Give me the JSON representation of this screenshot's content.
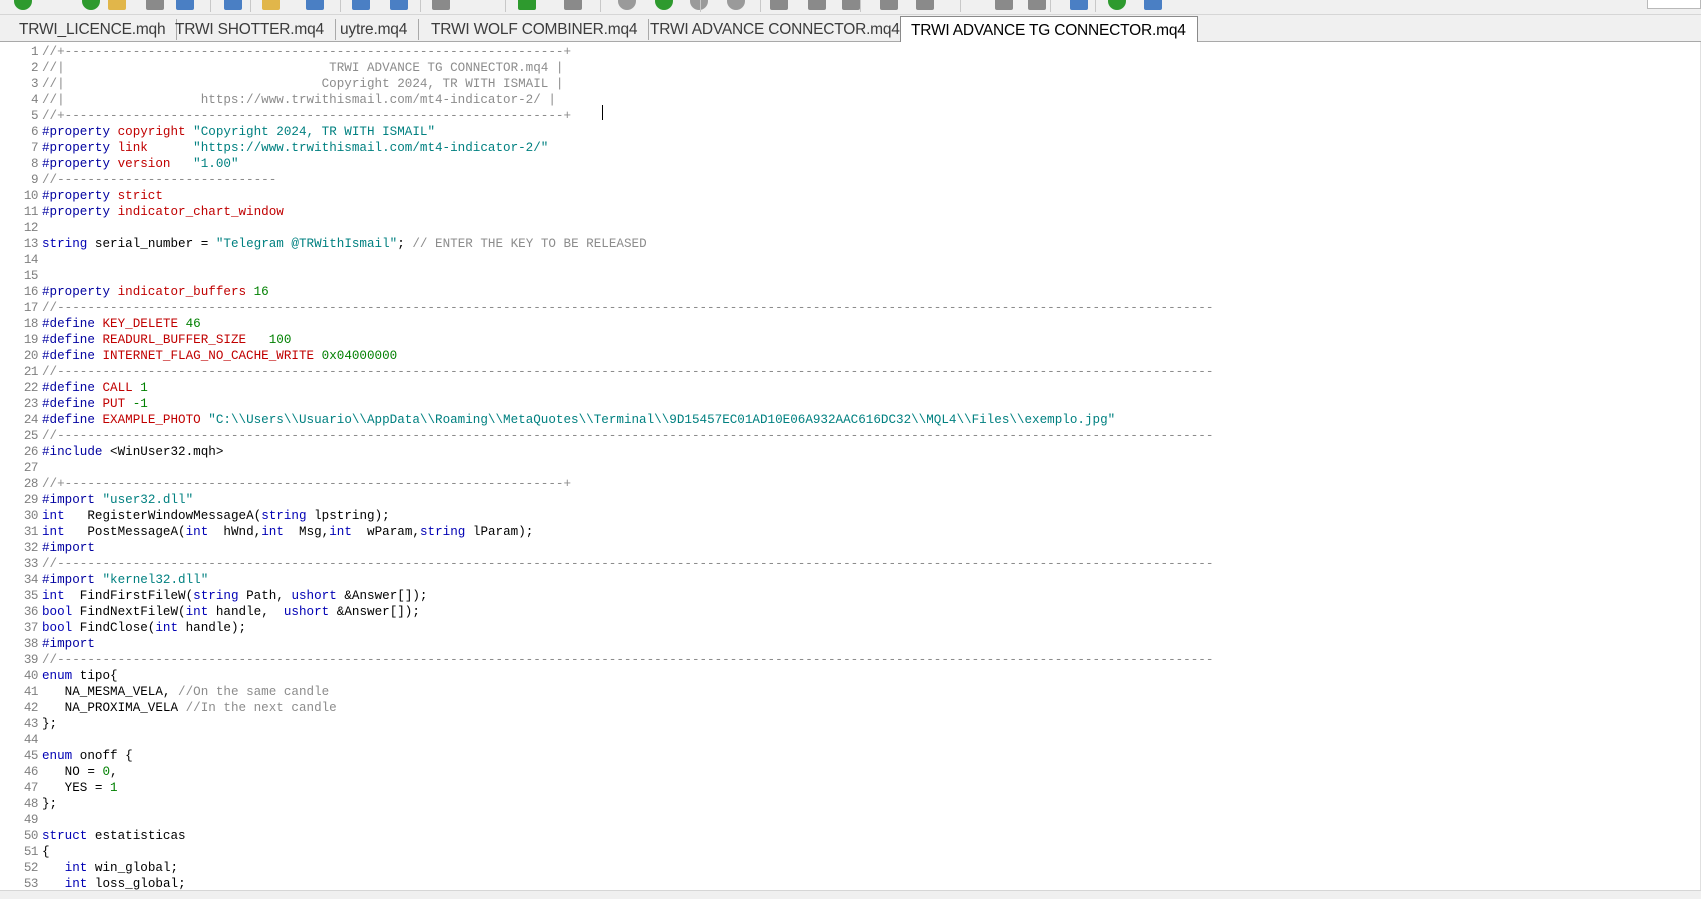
{
  "tabs": [
    {
      "label": "TRWI_LICENCE.mqh",
      "active": false
    },
    {
      "label": "TRWI SHOTTER.mq4",
      "active": false
    },
    {
      "label": "uytre.mq4",
      "active": false
    },
    {
      "label": "TRWI WOLF COMBINER.mq4",
      "active": false
    },
    {
      "label": "TRWI ADVANCE CONNECTOR.mq4",
      "active": false
    },
    {
      "label": "TRWI ADVANCE TG CONNECTOR.mq4",
      "active": true
    }
  ],
  "toolbar": {
    "icons": [
      "new-file-icon",
      "open-folder-icon",
      "save-icon",
      "save-all-icon",
      "compile-icon",
      "bookmark-icon",
      "undo-icon",
      "redo-icon",
      "download-icon",
      "start-debug-icon",
      "run-icon",
      "pause-icon",
      "stop-icon",
      "step-into-icon",
      "step-over-icon",
      "step-out-icon",
      "find-icon",
      "search-icon",
      "navigator-icon",
      "check-icon",
      "table-icon"
    ]
  },
  "colors": {
    "comment": "#8c8c8c",
    "preprocessor": "#0000a0",
    "keyword": "#0000b4",
    "property": "#c00000",
    "string": "#008080",
    "number": "#008000",
    "line_number": "#7f7f7f"
  },
  "editor": {
    "lines": [
      {
        "n": "1",
        "tokens": [
          [
            "comment",
            "//+------------------------------------------------------------------+"
          ]
        ]
      },
      {
        "n": "2",
        "tokens": [
          [
            "comment",
            "//|                                   TRWI ADVANCE TG CONNECTOR.mq4 |"
          ]
        ]
      },
      {
        "n": "3",
        "tokens": [
          [
            "comment",
            "//|                                  Copyright 2024, TR WITH ISMAIL |"
          ]
        ]
      },
      {
        "n": "4",
        "tokens": [
          [
            "comment",
            "//|                  https://www.trwithismail.com/mt4-indicator-2/ |"
          ]
        ]
      },
      {
        "n": "5",
        "tokens": [
          [
            "comment",
            "//+------------------------------------------------------------------+"
          ]
        ]
      },
      {
        "n": "6",
        "tokens": [
          [
            "pre",
            "#property "
          ],
          [
            "prop",
            "copyright "
          ],
          [
            "str",
            "\"Copyright 2024, TR WITH ISMAIL\""
          ]
        ]
      },
      {
        "n": "7",
        "tokens": [
          [
            "pre",
            "#property "
          ],
          [
            "prop",
            "link      "
          ],
          [
            "str",
            "\"https://www.trwithismail.com/mt4-indicator-2/\""
          ]
        ]
      },
      {
        "n": "8",
        "tokens": [
          [
            "pre",
            "#property "
          ],
          [
            "prop",
            "version   "
          ],
          [
            "str",
            "\"1.00\""
          ]
        ]
      },
      {
        "n": "9",
        "tokens": [
          [
            "comment",
            "//-----------------------------"
          ]
        ]
      },
      {
        "n": "10",
        "tokens": [
          [
            "pre",
            "#property "
          ],
          [
            "prop",
            "strict"
          ]
        ]
      },
      {
        "n": "11",
        "tokens": [
          [
            "pre",
            "#property "
          ],
          [
            "prop",
            "indicator_chart_window"
          ]
        ]
      },
      {
        "n": "12",
        "tokens": []
      },
      {
        "n": "13",
        "tokens": [
          [
            "kw",
            "string"
          ],
          [
            "plain",
            " serial_number = "
          ],
          [
            "str",
            "\"Telegram @TRWithIsmail\""
          ],
          [
            "plain",
            "; "
          ],
          [
            "comment",
            "// ENTER THE KEY TO BE RELEASED"
          ]
        ]
      },
      {
        "n": "14",
        "tokens": []
      },
      {
        "n": "15",
        "tokens": []
      },
      {
        "n": "16",
        "tokens": [
          [
            "pre",
            "#property "
          ],
          [
            "prop",
            "indicator_buffers "
          ],
          [
            "num",
            "16"
          ]
        ]
      },
      {
        "n": "17",
        "tokens": [
          [
            "comment",
            "//---------------------------------------------------------------------------------------------------------------------------------------------------------"
          ]
        ]
      },
      {
        "n": "18",
        "tokens": [
          [
            "pre",
            "#define "
          ],
          [
            "prop",
            "KEY_DELETE "
          ],
          [
            "num",
            "46"
          ]
        ]
      },
      {
        "n": "19",
        "tokens": [
          [
            "pre",
            "#define "
          ],
          [
            "prop",
            "READURL_BUFFER_SIZE   "
          ],
          [
            "num",
            "100"
          ]
        ]
      },
      {
        "n": "20",
        "tokens": [
          [
            "pre",
            "#define "
          ],
          [
            "prop",
            "INTERNET_FLAG_NO_CACHE_WRITE "
          ],
          [
            "num",
            "0x04000000"
          ]
        ]
      },
      {
        "n": "21",
        "tokens": [
          [
            "comment",
            "//---------------------------------------------------------------------------------------------------------------------------------------------------------"
          ]
        ]
      },
      {
        "n": "22",
        "tokens": [
          [
            "pre",
            "#define "
          ],
          [
            "prop",
            "CALL "
          ],
          [
            "num",
            "1"
          ]
        ]
      },
      {
        "n": "23",
        "tokens": [
          [
            "pre",
            "#define "
          ],
          [
            "prop",
            "PUT "
          ],
          [
            "num",
            "-1"
          ]
        ]
      },
      {
        "n": "24",
        "tokens": [
          [
            "pre",
            "#define "
          ],
          [
            "prop",
            "EXAMPLE_PHOTO "
          ],
          [
            "str",
            "\"C:\\\\Users\\\\Usuario\\\\AppData\\\\Roaming\\\\MetaQuotes\\\\Terminal\\\\9D15457EC01AD10E06A932AAC616DC32\\\\MQL4\\\\Files\\\\exemplo.jpg\""
          ]
        ]
      },
      {
        "n": "25",
        "tokens": [
          [
            "comment",
            "//---------------------------------------------------------------------------------------------------------------------------------------------------------"
          ]
        ]
      },
      {
        "n": "26",
        "tokens": [
          [
            "pre",
            "#include "
          ],
          [
            "plain",
            "<WinUser32.mqh>"
          ]
        ]
      },
      {
        "n": "27",
        "tokens": []
      },
      {
        "n": "28",
        "tokens": [
          [
            "comment",
            "//+------------------------------------------------------------------+"
          ]
        ]
      },
      {
        "n": "29",
        "tokens": [
          [
            "pre",
            "#import "
          ],
          [
            "str",
            "\"user32.dll\""
          ]
        ]
      },
      {
        "n": "30",
        "tokens": [
          [
            "kw",
            "int"
          ],
          [
            "plain",
            "   RegisterWindowMessageA("
          ],
          [
            "kw",
            "string"
          ],
          [
            "plain",
            " lpstring);"
          ]
        ]
      },
      {
        "n": "31",
        "tokens": [
          [
            "kw",
            "int"
          ],
          [
            "plain",
            "   PostMessageA("
          ],
          [
            "kw",
            "int"
          ],
          [
            "plain",
            "  hWnd,"
          ],
          [
            "kw",
            "int"
          ],
          [
            "plain",
            "  Msg,"
          ],
          [
            "kw",
            "int"
          ],
          [
            "plain",
            "  wParam,"
          ],
          [
            "kw",
            "string"
          ],
          [
            "plain",
            " lParam);"
          ]
        ]
      },
      {
        "n": "32",
        "tokens": [
          [
            "pre",
            "#import"
          ]
        ]
      },
      {
        "n": "33",
        "tokens": [
          [
            "comment",
            "//---------------------------------------------------------------------------------------------------------------------------------------------------------"
          ]
        ]
      },
      {
        "n": "34",
        "tokens": [
          [
            "pre",
            "#import "
          ],
          [
            "str",
            "\"kernel32.dll\""
          ]
        ]
      },
      {
        "n": "35",
        "tokens": [
          [
            "kw",
            "int"
          ],
          [
            "plain",
            "  FindFirstFileW("
          ],
          [
            "kw",
            "string"
          ],
          [
            "plain",
            " Path, "
          ],
          [
            "kw",
            "ushort"
          ],
          [
            "plain",
            " &Answer[]);"
          ]
        ]
      },
      {
        "n": "36",
        "tokens": [
          [
            "kw",
            "bool"
          ],
          [
            "plain",
            " FindNextFileW("
          ],
          [
            "kw",
            "int"
          ],
          [
            "plain",
            " handle,  "
          ],
          [
            "kw",
            "ushort"
          ],
          [
            "plain",
            " &Answer[]);"
          ]
        ]
      },
      {
        "n": "37",
        "tokens": [
          [
            "kw",
            "bool"
          ],
          [
            "plain",
            " FindClose("
          ],
          [
            "kw",
            "int"
          ],
          [
            "plain",
            " handle);"
          ]
        ]
      },
      {
        "n": "38",
        "tokens": [
          [
            "pre",
            "#import"
          ]
        ]
      },
      {
        "n": "39",
        "tokens": [
          [
            "comment",
            "//---------------------------------------------------------------------------------------------------------------------------------------------------------"
          ]
        ]
      },
      {
        "n": "40",
        "tokens": [
          [
            "kw",
            "enum"
          ],
          [
            "plain",
            " tipo{"
          ]
        ]
      },
      {
        "n": "41",
        "tokens": [
          [
            "plain",
            "   NA_MESMA_VELA, "
          ],
          [
            "comment",
            "//On the same candle"
          ]
        ]
      },
      {
        "n": "42",
        "tokens": [
          [
            "plain",
            "   NA_PROXIMA_VELA "
          ],
          [
            "comment",
            "//In the next candle"
          ]
        ]
      },
      {
        "n": "43",
        "tokens": [
          [
            "plain",
            "};"
          ]
        ]
      },
      {
        "n": "44",
        "tokens": []
      },
      {
        "n": "45",
        "tokens": [
          [
            "kw",
            "enum"
          ],
          [
            "plain",
            " onoff {"
          ]
        ]
      },
      {
        "n": "46",
        "tokens": [
          [
            "plain",
            "   NO = "
          ],
          [
            "num",
            "0"
          ],
          [
            "plain",
            ","
          ]
        ]
      },
      {
        "n": "47",
        "tokens": [
          [
            "plain",
            "   YES = "
          ],
          [
            "num",
            "1"
          ]
        ]
      },
      {
        "n": "48",
        "tokens": [
          [
            "plain",
            "};"
          ]
        ]
      },
      {
        "n": "49",
        "tokens": []
      },
      {
        "n": "50",
        "tokens": [
          [
            "kw",
            "struct"
          ],
          [
            "plain",
            " estatisticas"
          ]
        ]
      },
      {
        "n": "51",
        "tokens": [
          [
            "plain",
            "{"
          ]
        ]
      },
      {
        "n": "52",
        "tokens": [
          [
            "plain",
            "   "
          ],
          [
            "kw",
            "int"
          ],
          [
            "plain",
            " win_global;"
          ]
        ]
      },
      {
        "n": "53",
        "tokens": [
          [
            "plain",
            "   "
          ],
          [
            "kw",
            "int"
          ],
          [
            "plain",
            " loss_global;"
          ]
        ]
      }
    ]
  }
}
